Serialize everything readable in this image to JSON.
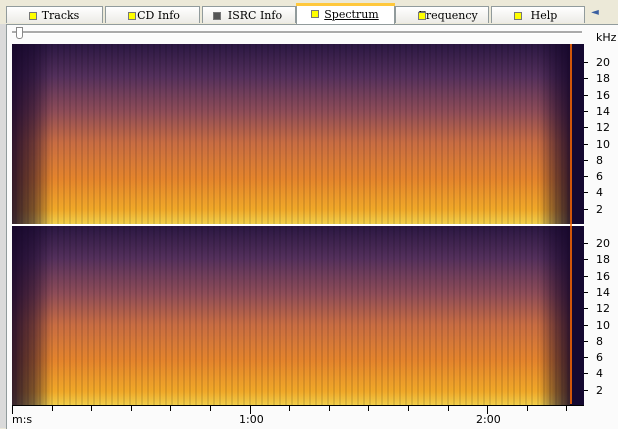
{
  "tabs": [
    {
      "label": "Tracks",
      "icon": "yellow-square-icon"
    },
    {
      "label": "CD Info",
      "icon": "yellow-square-icon"
    },
    {
      "label": "ISRC Info",
      "icon": "gray-square-icon"
    },
    {
      "label": "Spectrum",
      "icon": "yellow-square-icon",
      "active": true
    },
    {
      "label": "Frequency",
      "icon": "yellow-square-icon"
    },
    {
      "label": "Help",
      "icon": "yellow-square-icon"
    }
  ],
  "nav": {
    "left": "◄",
    "right": "►"
  },
  "chart": {
    "unit_label": "kHz",
    "y_ticks": [
      "20",
      "18",
      "16",
      "14",
      "12",
      "10",
      "8",
      "6",
      "4",
      "2"
    ],
    "x_unit_label": "m:s",
    "x_labels": [
      "1:00",
      "2:00"
    ]
  },
  "colors": {
    "accent_tab": "#ffc83c",
    "spectrum_low": "#ffdc50",
    "spectrum_mid": "#f07810",
    "spectrum_high": "#220c3c"
  }
}
